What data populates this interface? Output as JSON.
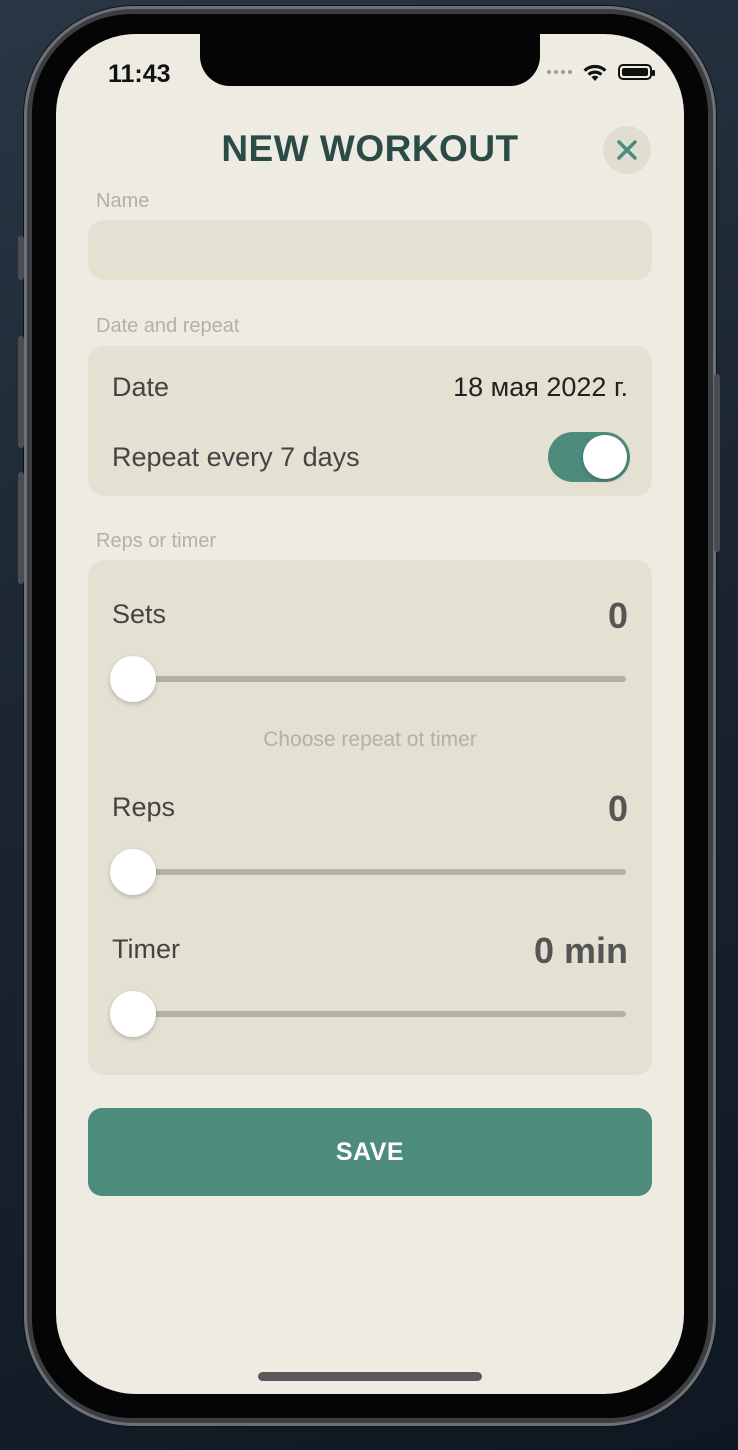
{
  "status_bar": {
    "time": "11:43"
  },
  "header": {
    "title": "NEW WORKOUT"
  },
  "name_section": {
    "label": "Name",
    "value": "",
    "placeholder": ""
  },
  "date_section": {
    "label": "Date and repeat",
    "date_label": "Date",
    "date_value": "18 мая 2022 г.",
    "repeat_label": "Repeat every 7 days",
    "repeat_enabled": true
  },
  "reps_section": {
    "label": "Reps or timer",
    "sets_label": "Sets",
    "sets_value": "0",
    "hint": "Choose repeat ot timer",
    "reps_label": "Reps",
    "reps_value": "0",
    "timer_label": "Timer",
    "timer_value": "0 min"
  },
  "save_label": "SAVE",
  "colors": {
    "accent": "#4d8b7c",
    "title": "#2b4b46",
    "background": "#eeebe3",
    "card": "#e4e0d2"
  }
}
